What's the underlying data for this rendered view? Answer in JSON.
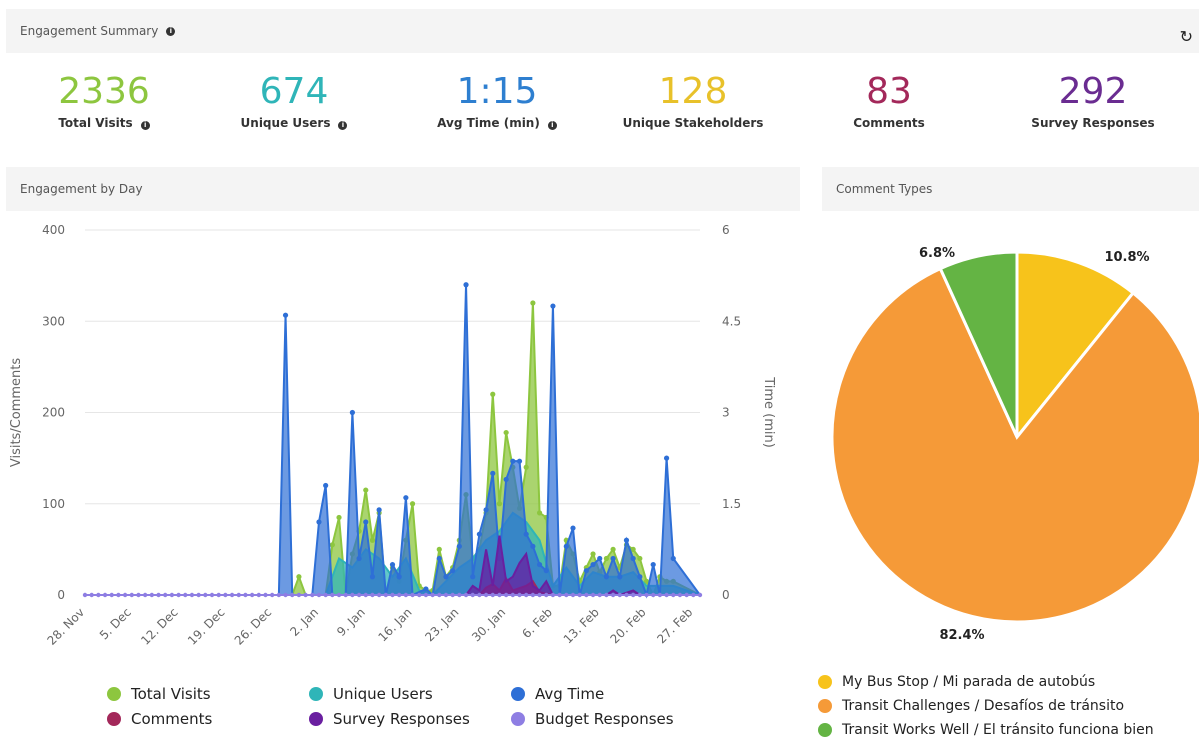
{
  "summary": {
    "title": "Engagement Summary",
    "refresh_icon": "refresh-icon",
    "kpis": [
      {
        "value": "2336",
        "label": "Total Visits",
        "color": "#8dc63f",
        "info": true
      },
      {
        "value": "674",
        "label": "Unique Users",
        "color": "#2fb5b8",
        "info": true
      },
      {
        "value": "1:15",
        "label": "Avg Time (min)",
        "color": "#2e7fd0",
        "info": true
      },
      {
        "value": "128",
        "label": "Unique Stakeholders",
        "color": "#e8c12a",
        "info": false
      },
      {
        "value": "83",
        "label": "Comments",
        "color": "#a3285a",
        "info": false
      },
      {
        "value": "292",
        "label": "Survey Responses",
        "color": "#6a2c91",
        "info": false
      }
    ]
  },
  "engagement_panel": {
    "title": "Engagement by Day"
  },
  "comments_panel": {
    "title": "Comment Types"
  },
  "chart_data": [
    {
      "type": "area",
      "title": "Engagement by Day",
      "ylabel": "Visits/Comments",
      "y2label": "Time (min)",
      "ylim": [
        0,
        400
      ],
      "y2lim": [
        0,
        6
      ],
      "yticks": [
        "0",
        "100",
        "200",
        "300",
        "400"
      ],
      "y2ticks": [
        "0",
        "1.5",
        "3",
        "4.5",
        "6"
      ],
      "xticks": [
        "28. Nov",
        "5. Dec",
        "12. Dec",
        "19. Dec",
        "26. Dec",
        "2. Jan",
        "9. Jan",
        "16. Jan",
        "23. Jan",
        "30. Jan",
        "6. Feb",
        "13. Feb",
        "20. Feb",
        "27. Feb"
      ],
      "x_start": "2016-11-28",
      "days": 93,
      "legend_position": "bottom",
      "grid": true,
      "series": [
        {
          "name": "Total Visits",
          "color": "#8dc63f",
          "axis": "left",
          "points": [
            [
              0,
              0
            ],
            [
              31,
              0
            ],
            [
              32,
              20
            ],
            [
              33,
              0
            ],
            [
              34,
              0
            ],
            [
              36,
              0
            ],
            [
              37,
              55
            ],
            [
              38,
              85
            ],
            [
              39,
              0
            ],
            [
              40,
              45
            ],
            [
              41,
              70
            ],
            [
              42,
              115
            ],
            [
              43,
              60
            ],
            [
              44,
              90
            ],
            [
              45,
              0
            ],
            [
              46,
              30
            ],
            [
              47,
              15
            ],
            [
              48,
              60
            ],
            [
              49,
              100
            ],
            [
              50,
              10
            ],
            [
              51,
              5
            ],
            [
              52,
              5
            ],
            [
              53,
              50
            ],
            [
              54,
              20
            ],
            [
              55,
              30
            ],
            [
              56,
              60
            ],
            [
              57,
              110
            ],
            [
              58,
              40
            ],
            [
              59,
              50
            ],
            [
              60,
              90
            ],
            [
              61,
              220
            ],
            [
              62,
              100
            ],
            [
              63,
              178
            ],
            [
              64,
              140
            ],
            [
              65,
              95
            ],
            [
              66,
              140
            ],
            [
              67,
              320
            ],
            [
              68,
              90
            ],
            [
              69,
              85
            ],
            [
              70,
              10
            ],
            [
              71,
              10
            ],
            [
              72,
              60
            ],
            [
              73,
              45
            ],
            [
              74,
              15
            ],
            [
              75,
              30
            ],
            [
              76,
              45
            ],
            [
              77,
              25
            ],
            [
              78,
              40
            ],
            [
              79,
              50
            ],
            [
              80,
              30
            ],
            [
              81,
              55
            ],
            [
              82,
              50
            ],
            [
              83,
              40
            ],
            [
              84,
              15
            ],
            [
              85,
              0
            ],
            [
              86,
              20
            ],
            [
              87,
              15
            ],
            [
              88,
              15
            ],
            [
              92,
              0
            ]
          ]
        },
        {
          "name": "Unique Users",
          "color": "#2fb5b8",
          "axis": "left",
          "points": [
            [
              0,
              0
            ],
            [
              36,
              0
            ],
            [
              38,
              40
            ],
            [
              40,
              30
            ],
            [
              42,
              50
            ],
            [
              44,
              40
            ],
            [
              46,
              20
            ],
            [
              48,
              40
            ],
            [
              50,
              5
            ],
            [
              52,
              0
            ],
            [
              54,
              15
            ],
            [
              56,
              30
            ],
            [
              58,
              40
            ],
            [
              60,
              60
            ],
            [
              62,
              70
            ],
            [
              64,
              90
            ],
            [
              66,
              80
            ],
            [
              68,
              60
            ],
            [
              70,
              10
            ],
            [
              72,
              30
            ],
            [
              74,
              10
            ],
            [
              76,
              25
            ],
            [
              78,
              20
            ],
            [
              80,
              20
            ],
            [
              82,
              25
            ],
            [
              84,
              10
            ],
            [
              86,
              10
            ],
            [
              88,
              10
            ],
            [
              92,
              0
            ]
          ]
        },
        {
          "name": "Avg Time",
          "color": "#2e6fd6",
          "axis": "right",
          "points": [
            [
              0,
              0
            ],
            [
              29,
              0
            ],
            [
              30,
              4.6
            ],
            [
              31,
              0
            ],
            [
              34,
              0
            ],
            [
              35,
              1.2
            ],
            [
              36,
              1.8
            ],
            [
              37,
              0
            ],
            [
              39,
              0
            ],
            [
              40,
              3.0
            ],
            [
              41,
              0.6
            ],
            [
              42,
              1.2
            ],
            [
              43,
              0.3
            ],
            [
              44,
              1.4
            ],
            [
              45,
              0
            ],
            [
              46,
              0.5
            ],
            [
              47,
              0.3
            ],
            [
              48,
              1.6
            ],
            [
              49,
              0
            ],
            [
              51,
              0.1
            ],
            [
              52,
              0
            ],
            [
              53,
              0.6
            ],
            [
              54,
              0.3
            ],
            [
              55,
              0.4
            ],
            [
              56,
              0.8
            ],
            [
              57,
              5.1
            ],
            [
              58,
              0.3
            ],
            [
              59,
              1.0
            ],
            [
              60,
              1.4
            ],
            [
              61,
              2.0
            ],
            [
              62,
              0.6
            ],
            [
              63,
              1.9
            ],
            [
              64,
              2.2
            ],
            [
              65,
              2.2
            ],
            [
              66,
              1.0
            ],
            [
              67,
              0.8
            ],
            [
              68,
              0.5
            ],
            [
              69,
              0.4
            ],
            [
              70,
              4.75
            ],
            [
              71,
              0
            ],
            [
              72,
              0.8
            ],
            [
              73,
              1.1
            ],
            [
              74,
              0
            ],
            [
              75,
              0.4
            ],
            [
              76,
              0.5
            ],
            [
              77,
              0.6
            ],
            [
              78,
              0.3
            ],
            [
              79,
              0.6
            ],
            [
              80,
              0.3
            ],
            [
              81,
              0.9
            ],
            [
              82,
              0.6
            ],
            [
              83,
              0.3
            ],
            [
              84,
              0
            ],
            [
              85,
              0.5
            ],
            [
              86,
              0
            ],
            [
              87,
              2.25
            ],
            [
              88,
              0.6
            ],
            [
              92,
              0
            ]
          ]
        },
        {
          "name": "Comments",
          "color": "#a3285a",
          "axis": "left",
          "points": [
            [
              0,
              0
            ],
            [
              59,
              0
            ],
            [
              60,
              8
            ],
            [
              61,
              12
            ],
            [
              62,
              5
            ],
            [
              63,
              18
            ],
            [
              64,
              5
            ],
            [
              66,
              10
            ],
            [
              67,
              15
            ],
            [
              68,
              3
            ],
            [
              70,
              0
            ],
            [
              92,
              0
            ]
          ]
        },
        {
          "name": "Survey Responses",
          "color": "#6a1fa0",
          "axis": "left",
          "points": [
            [
              0,
              0
            ],
            [
              57,
              0
            ],
            [
              58,
              10
            ],
            [
              59,
              5
            ],
            [
              60,
              50
            ],
            [
              61,
              10
            ],
            [
              62,
              65
            ],
            [
              63,
              15
            ],
            [
              64,
              20
            ],
            [
              65,
              35
            ],
            [
              66,
              45
            ],
            [
              67,
              10
            ],
            [
              68,
              5
            ],
            [
              69,
              15
            ],
            [
              70,
              0
            ],
            [
              78,
              0
            ],
            [
              79,
              5
            ],
            [
              80,
              0
            ],
            [
              82,
              5
            ],
            [
              83,
              0
            ],
            [
              92,
              0
            ]
          ]
        },
        {
          "name": "Budget Responses",
          "color": "#8e7ee3",
          "axis": "left",
          "points": [
            [
              0,
              0
            ],
            [
              92,
              0
            ]
          ]
        }
      ]
    },
    {
      "type": "pie",
      "title": "Comment Types",
      "legend_position": "bottom",
      "slices": [
        {
          "label": "My Bus Stop / Mi parada de autobús",
          "value": 10.8,
          "display": "10.8%",
          "color": "#f7c31b"
        },
        {
          "label": "Transit Challenges / Desafíos de tránsito",
          "value": 82.4,
          "display": "82.4%",
          "color": "#f59a38"
        },
        {
          "label": "Transit Works Well / El tránsito funciona bien",
          "value": 6.8,
          "display": "6.8%",
          "color": "#64b444"
        }
      ]
    }
  ]
}
